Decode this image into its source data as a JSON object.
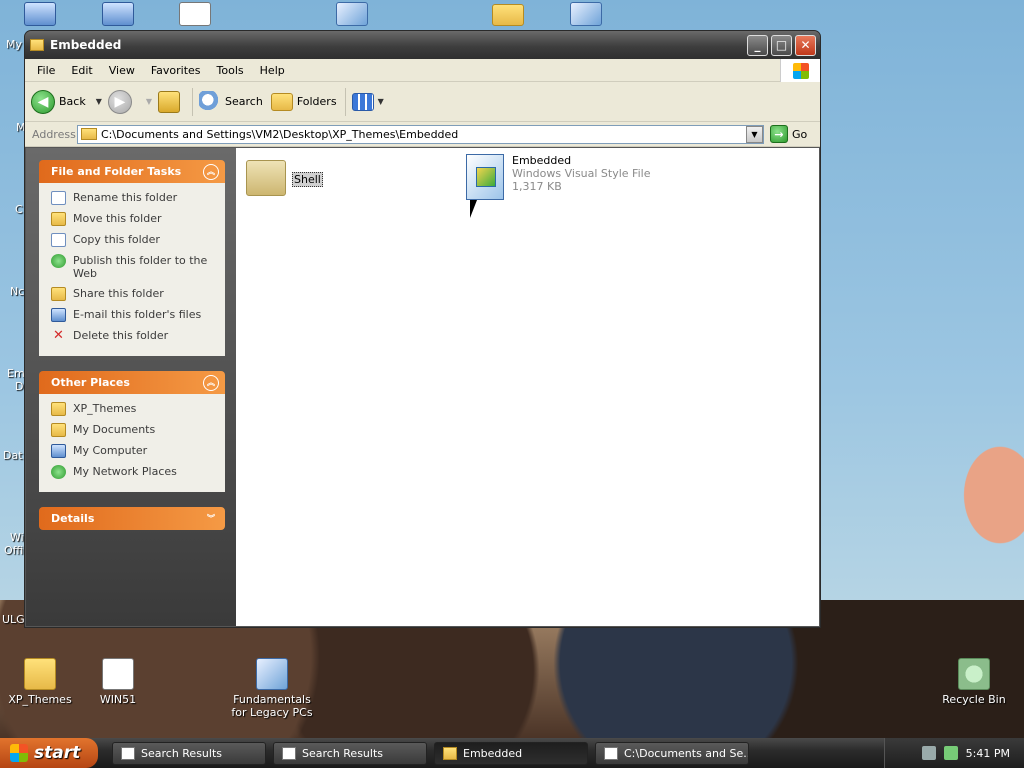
{
  "desktop": {
    "top_icons": [
      "my-computer-icon",
      "my-network-icon",
      "win51-icon",
      "visual-style-icon",
      "folder-icon",
      "visual-style-icon"
    ],
    "edge_labels": [
      "My",
      "M",
      "C",
      "Nc",
      "Em",
      "D",
      "Dat",
      "Wi",
      "Offi",
      "ULG"
    ],
    "icons": [
      {
        "label": "XP_Themes"
      },
      {
        "label": "WIN51"
      },
      {
        "label": "Fundamentals for Legacy PCs"
      },
      {
        "label": "Recycle Bin"
      }
    ]
  },
  "window": {
    "title": "Embedded",
    "menu": [
      "File",
      "Edit",
      "View",
      "Favorites",
      "Tools",
      "Help"
    ],
    "toolbar": {
      "back": "Back",
      "search": "Search",
      "folders": "Folders"
    },
    "address": {
      "label": "Address",
      "value": "C:\\Documents and Settings\\VM2\\Desktop\\XP_Themes\\Embedded",
      "go": "Go"
    }
  },
  "tasks": {
    "file_folder": {
      "title": "File and Folder Tasks",
      "items": [
        "Rename this folder",
        "Move this folder",
        "Copy this folder",
        "Publish this folder to the Web",
        "Share this folder",
        "E-mail this folder's files",
        "Delete this folder"
      ]
    },
    "other_places": {
      "title": "Other Places",
      "items": [
        "XP_Themes",
        "My Documents",
        "My Computer",
        "My Network Places"
      ]
    },
    "details": {
      "title": "Details"
    }
  },
  "files": [
    {
      "name": "Shell",
      "type": "folder"
    },
    {
      "name": "Embedded",
      "type": "Windows Visual Style File",
      "size": "1,317 KB"
    }
  ],
  "taskbar": {
    "start": "start",
    "buttons": [
      "Search Results",
      "Search Results",
      "Embedded",
      "C:\\Documents and Se..."
    ],
    "clock": "5:41 PM"
  }
}
